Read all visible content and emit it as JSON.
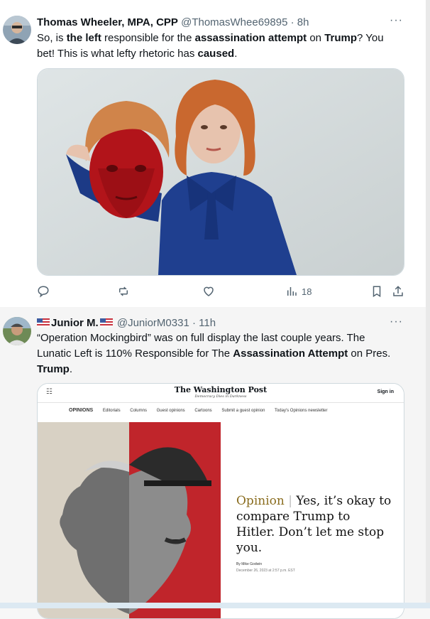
{
  "tweets": [
    {
      "author": "Thomas Wheeler, MPA, CPP",
      "handle": "@ThomasWhee69895",
      "time": "· 8h",
      "more": "···",
      "text_parts": [
        "So, is ",
        "the left",
        " responsible for the ",
        "assassination attempt",
        " on ",
        "Trump",
        "? You bet! This is what lefty rhetoric has ",
        "caused",
        "."
      ],
      "avatar_icon": "person-avatar",
      "media_icon": "photo-person-holding-mask",
      "stats": {
        "views": "18"
      }
    },
    {
      "author": "Junior M.",
      "handle": "@JuniorM0331",
      "time": "· 11h",
      "more": "···",
      "text_parts": [
        "“Operation Mockingbird” was on full display the last couple years. The Lunatic Left is 110% Responsible for The ",
        "Assassination Attempt",
        " on Pres. ",
        "Trump",
        "."
      ],
      "avatar_icon": "person-avatar",
      "media": {
        "site_title": "The Washington Post",
        "tagline": "Democracy Dies in Darkness",
        "left_icon": "☷",
        "signin": "Sign in",
        "nav": [
          "OPINIONS",
          "Editorials",
          "Columns",
          "Guest opinions",
          "Cartoons",
          "Submit a guest opinion",
          "Today's Opinions newsletter"
        ],
        "headline_label": "Opinion",
        "headline": "Yes, it’s okay to compare Trump to Hitler. Don’t let me stop you.",
        "byline": "By Mike Godwin",
        "dateline": "December 26, 2023 at 2:57 p.m. EST"
      }
    }
  ],
  "colors": {
    "accent": "#1d9bf0",
    "muted": "#536471",
    "wapo_red": "#c0252b"
  }
}
